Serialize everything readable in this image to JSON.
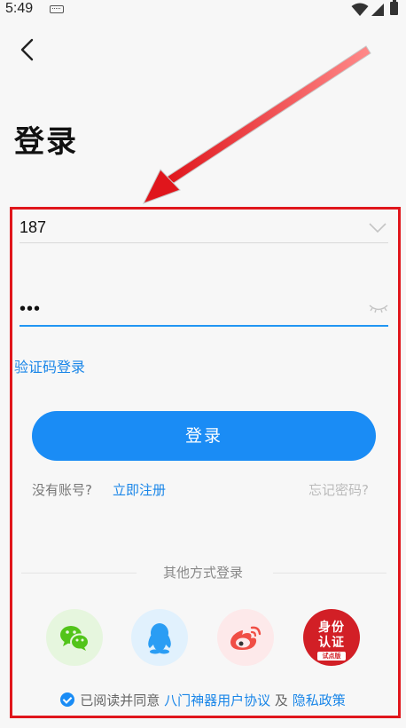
{
  "status_bar": {
    "time": "5:49"
  },
  "title": "登录",
  "account_field": {
    "value": "187"
  },
  "password_field": {
    "value": "•••"
  },
  "sms_login_label": "验证码登录",
  "login_button_label": "登录",
  "no_account_text": "没有账号?",
  "register_label": "立即注册",
  "forgot_password_label": "忘记密码?",
  "other_login_title": "其他方式登录",
  "social_logins": [
    {
      "name": "wechat",
      "icon": "wechat-icon"
    },
    {
      "name": "qq",
      "icon": "qq-icon"
    },
    {
      "name": "weibo",
      "icon": "weibo-icon"
    },
    {
      "name": "id-auth",
      "icon": "id-auth-icon",
      "label_line1": "身份",
      "label_line2": "认证",
      "label_line3": "试点版"
    }
  ],
  "agreement": {
    "prefix": "已阅读并同意",
    "user_agreement": "八门神器用户协议",
    "and": "及",
    "privacy_policy": "隐私政策"
  },
  "colors": {
    "accent": "#1a8cf5",
    "link": "#1a86e8",
    "annotation_red": "#e0161c"
  }
}
